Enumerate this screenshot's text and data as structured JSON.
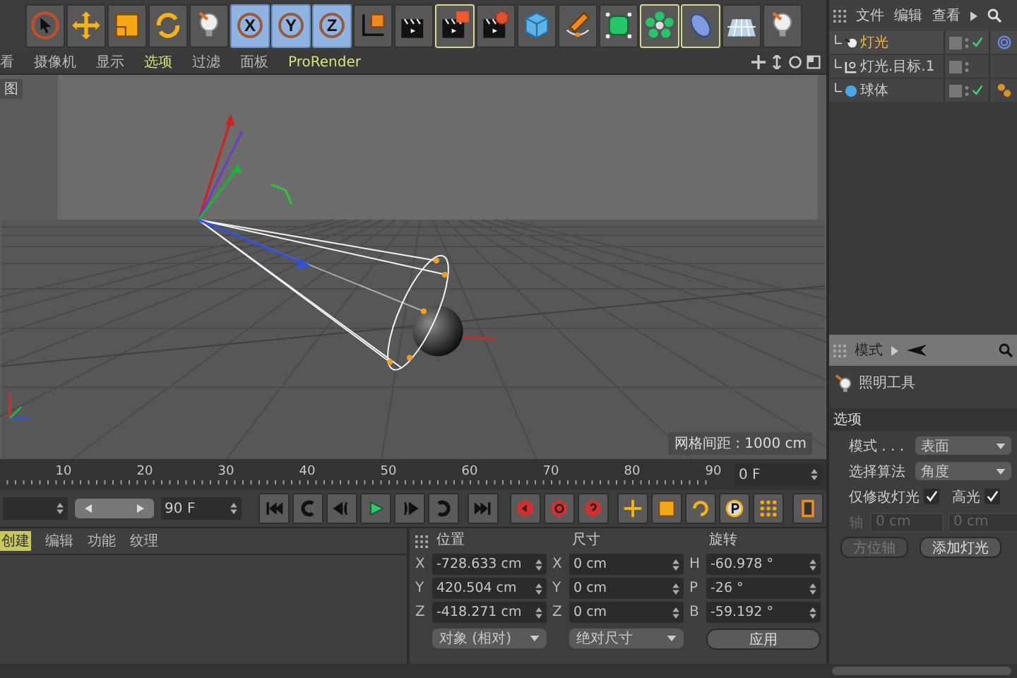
{
  "toolbar": [
    {
      "kind": "select",
      "on": false
    },
    {
      "kind": "move",
      "on": false
    },
    {
      "kind": "scale",
      "on": false
    },
    {
      "kind": "rotate",
      "on": false
    },
    {
      "kind": "bulb",
      "on": false
    },
    {
      "kind": "axis",
      "label": "X",
      "on": true
    },
    {
      "kind": "axis",
      "label": "Y",
      "on": true
    },
    {
      "kind": "axis",
      "label": "Z",
      "on": true
    },
    {
      "kind": "coords",
      "on": false
    },
    {
      "kind": "clapper",
      "on": false
    },
    {
      "kind": "clapper-view",
      "on": true
    },
    {
      "kind": "clapper-gear",
      "on": false
    },
    {
      "kind": "cube",
      "on": false
    },
    {
      "kind": "pen",
      "on": false
    },
    {
      "kind": "subdivide",
      "on": false
    },
    {
      "kind": "cloner",
      "on": true
    },
    {
      "kind": "deformer",
      "on": true
    },
    {
      "kind": "floor",
      "on": false
    },
    {
      "kind": "bulb",
      "on": false
    }
  ],
  "viewport_menu": [
    {
      "label": "看",
      "highlighted": false
    },
    {
      "label": "摄像机",
      "highlighted": false
    },
    {
      "label": "显示",
      "highlighted": false
    },
    {
      "label": "选项",
      "highlighted": true
    },
    {
      "label": "过滤",
      "highlighted": false
    },
    {
      "label": "面板",
      "highlighted": false
    },
    {
      "label": "ProRender",
      "highlighted": true
    }
  ],
  "viewport": {
    "title": "图",
    "grid_label": "网格间距 : 1000 cm"
  },
  "timeline": {
    "ticks": [
      "10",
      "20",
      "30",
      "40",
      "50",
      "60",
      "70",
      "80",
      "90"
    ],
    "frame_field": "0 F"
  },
  "playback": {
    "range": {
      "level": 1
    },
    "end_field": "90 F",
    "buttons": [
      {
        "kind": "first"
      },
      {
        "kind": "loop-back"
      },
      {
        "kind": "prev"
      },
      {
        "kind": "play"
      },
      {
        "kind": "next"
      },
      {
        "kind": "loop-fwd"
      },
      {
        "kind": "last"
      },
      {
        "kind": "record"
      },
      {
        "kind": "record-auto"
      },
      {
        "kind": "keyframe"
      },
      {
        "kind": "move-key"
      },
      {
        "kind": "scale-key"
      },
      {
        "kind": "rotate-key"
      },
      {
        "kind": "param-key"
      },
      {
        "kind": "grid-key"
      },
      {
        "kind": "film"
      }
    ]
  },
  "bottom_tabs": [
    {
      "label": "创建",
      "selected": true
    },
    {
      "label": "编辑",
      "selected": false
    },
    {
      "label": "功能",
      "selected": false
    },
    {
      "label": "纹理",
      "selected": false
    }
  ],
  "coordinates": {
    "columns": [
      {
        "header": "位置",
        "fields": [
          {
            "axis": "X",
            "value": "-728.633 cm"
          },
          {
            "axis": "Y",
            "value": "420.504 cm"
          },
          {
            "axis": "Z",
            "value": "-418.271 cm"
          }
        ],
        "footer": {
          "kind": "dropdown",
          "label": "对象 (相对)"
        }
      },
      {
        "header": "尺寸",
        "fields": [
          {
            "axis": "X",
            "value": "0 cm"
          },
          {
            "axis": "Y",
            "value": "0 cm"
          },
          {
            "axis": "Z",
            "value": "0 cm"
          }
        ],
        "footer": {
          "kind": "dropdown",
          "label": "绝对尺寸"
        }
      },
      {
        "header": "旋转",
        "fields": [
          {
            "axis": "H",
            "value": "-60.978 °"
          },
          {
            "axis": "P",
            "value": "-26 °"
          },
          {
            "axis": "B",
            "value": "-59.192 °"
          }
        ],
        "footer": {
          "kind": "button",
          "label": "应用"
        }
      }
    ]
  },
  "object_manager": {
    "menu": [
      "文件",
      "编辑",
      "查看"
    ],
    "objects": [
      {
        "name": "灯光",
        "kind": "light",
        "selected": true,
        "enabled": true
      },
      {
        "name": "灯光.目标.1",
        "kind": "null",
        "selected": false,
        "enabled": false
      },
      {
        "name": "球体",
        "kind": "sphere",
        "selected": false,
        "enabled": true
      }
    ]
  },
  "attributes": {
    "menu": "模式",
    "tool_title": "照明工具",
    "section": "选项",
    "rows": [
      {
        "kind": "dropdown",
        "label": "模式 . . .",
        "value": "表面"
      },
      {
        "kind": "dropdown",
        "label": "选择算法",
        "value": "角度"
      },
      {
        "kind": "checks",
        "items": [
          {
            "label": "仅修改灯光",
            "checked": true
          },
          {
            "label": "高光",
            "checked": true
          }
        ]
      },
      {
        "kind": "axis",
        "label": "轴",
        "values": [
          "0 cm",
          "0 cm"
        ],
        "disabled": true
      }
    ],
    "buttons": [
      {
        "label": "方位轴",
        "disabled": true
      },
      {
        "label": "添加灯光",
        "disabled": false
      }
    ]
  }
}
